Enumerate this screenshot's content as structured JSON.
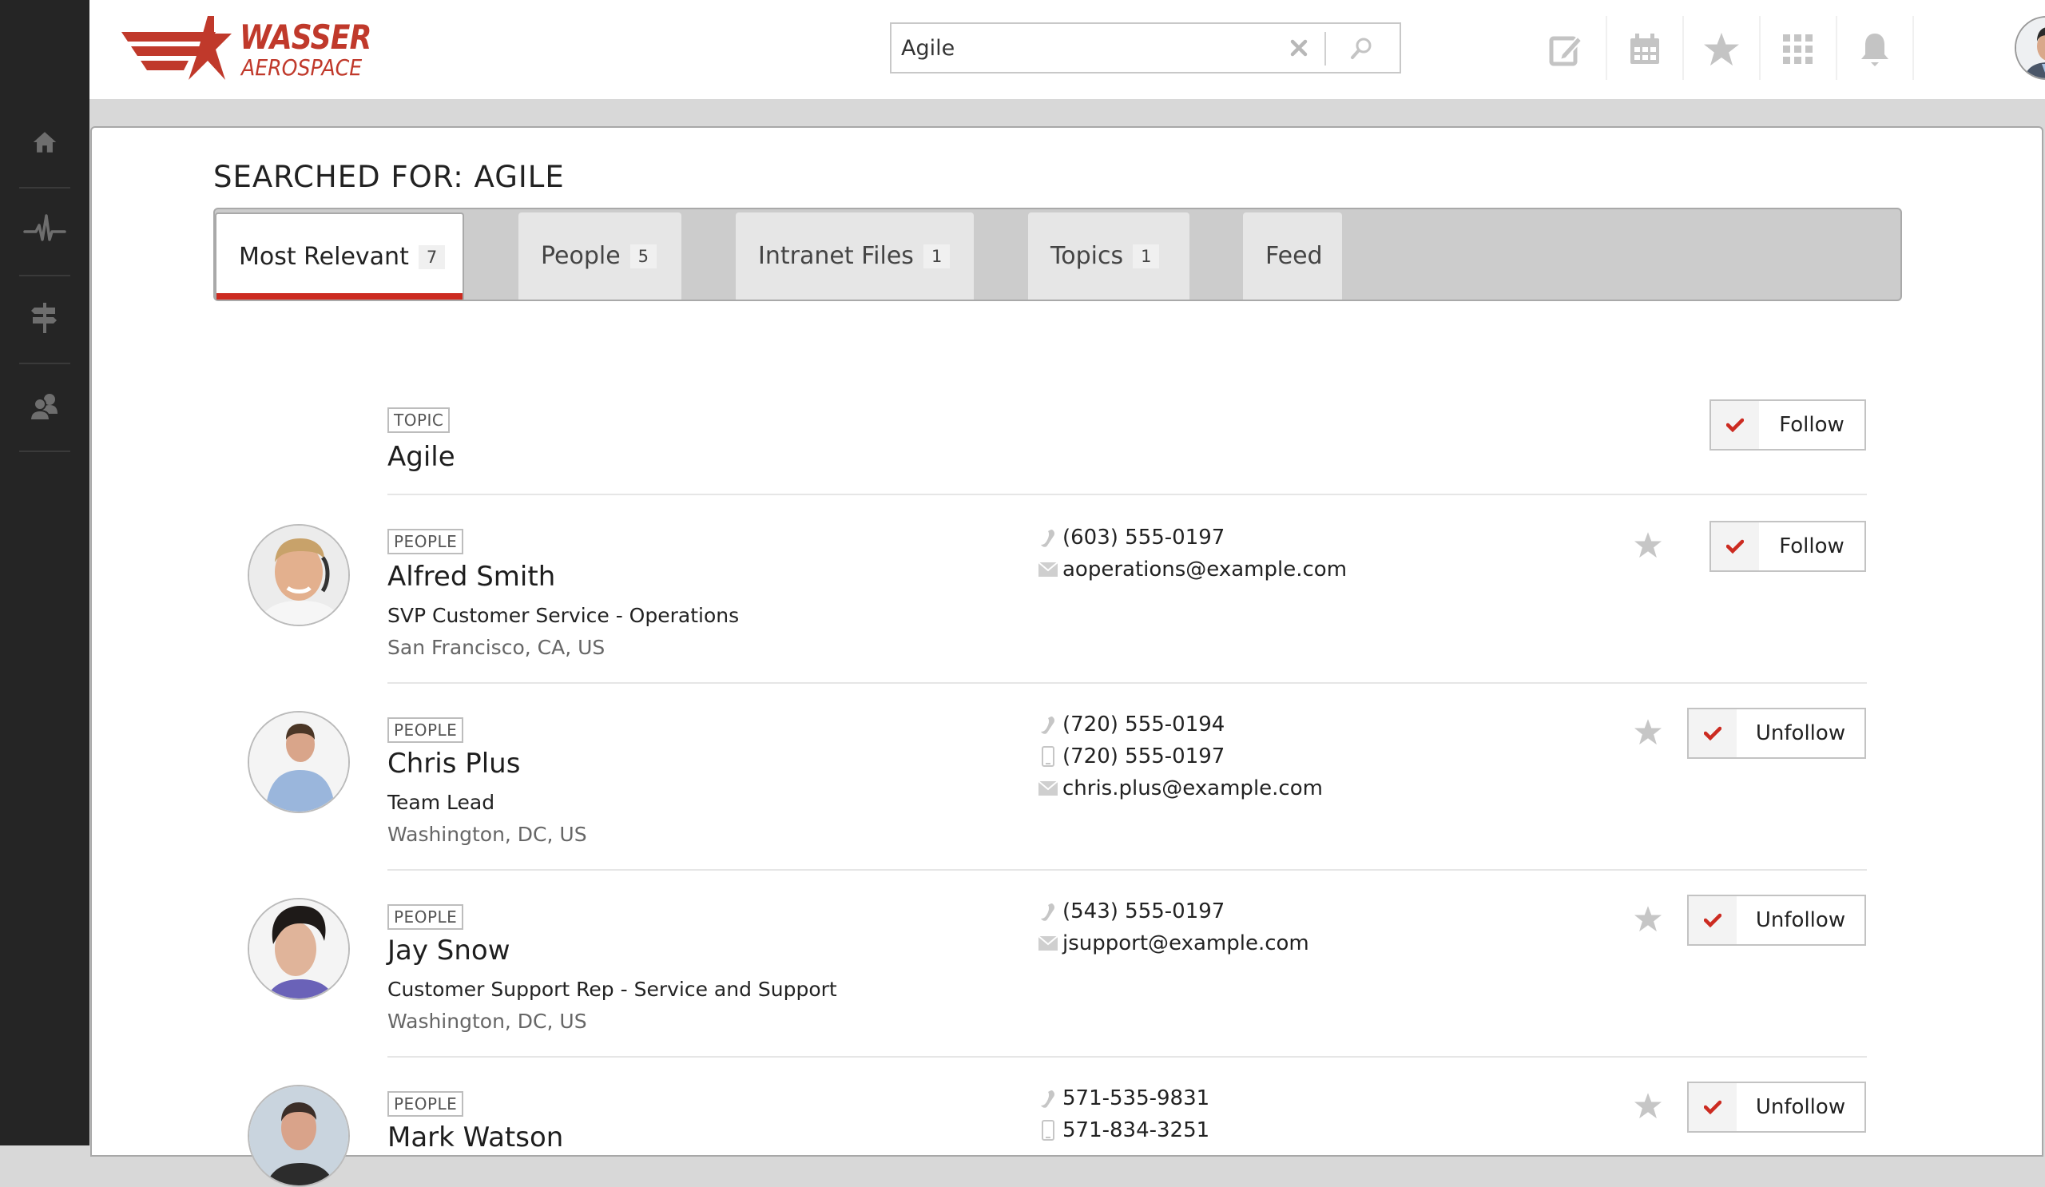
{
  "brand": {
    "name": "WASSER",
    "subtitle": "AEROSPACE",
    "color": "#c0392b"
  },
  "sidebar": {
    "items": [
      {
        "name": "home",
        "icon": "home-icon"
      },
      {
        "name": "activity",
        "icon": "pulse-icon"
      },
      {
        "name": "directions",
        "icon": "signpost-icon"
      },
      {
        "name": "people",
        "icon": "people-icon"
      }
    ]
  },
  "search": {
    "value": "Agile",
    "placeholder": "",
    "clear_icon": "close-icon",
    "submit_icon": "search-icon"
  },
  "header_icons": [
    "compose-icon",
    "calendar-icon",
    "star-icon",
    "apps-grid-icon",
    "bell-icon"
  ],
  "page_title": "SEARCHED FOR: AGILE",
  "tabs": [
    {
      "label": "Most Relevant",
      "count": "7",
      "active": true
    },
    {
      "label": "People",
      "count": "5"
    },
    {
      "label": "Intranet Files",
      "count": "1"
    },
    {
      "label": "Topics",
      "count": "1"
    },
    {
      "label": "Feed",
      "count": null
    }
  ],
  "accent_color": "#cc2b21",
  "results": [
    {
      "type": "TOPIC",
      "name": "Agile",
      "follow_label": "Follow"
    },
    {
      "type": "PEOPLE",
      "name": "Alfred Smith",
      "title": "SVP Customer Service - Operations",
      "location": "San Francisco, CA, US",
      "phone": "(603) 555-0197",
      "email": "aoperations@example.com",
      "follow_label": "Follow"
    },
    {
      "type": "PEOPLE",
      "name": "Chris Plus",
      "title": "Team Lead",
      "location": "Washington, DC, US",
      "phone": "(720) 555-0194",
      "mobile": "(720) 555-0197",
      "email": "chris.plus@example.com",
      "follow_label": "Unfollow"
    },
    {
      "type": "PEOPLE",
      "name": "Jay Snow",
      "title": "Customer Support Rep - Service and Support",
      "location": "Washington, DC, US",
      "phone": "(543) 555-0197",
      "email": "jsupport@example.com",
      "follow_label": "Unfollow"
    },
    {
      "type": "PEOPLE",
      "name": "Mark Watson",
      "phone": "571-535-9831",
      "mobile": "571-834-3251",
      "follow_label": "Unfollow"
    }
  ]
}
